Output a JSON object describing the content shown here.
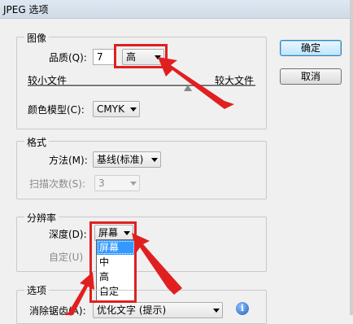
{
  "window": {
    "title": "JPEG 选项"
  },
  "buttons": {
    "ok": "确定",
    "cancel": "取消"
  },
  "image_group": {
    "title": "图像",
    "quality_label": "品质(Q):",
    "quality_value": "7",
    "quality_level": "高",
    "small_file": "较小文件",
    "large_file": "较大文件",
    "color_model_label": "颜色模型(C):",
    "color_model_value": "CMYK"
  },
  "format_group": {
    "title": "格式",
    "method_label": "方法(M):",
    "method_value": "基线(标准)",
    "scans_label": "扫描次数(S):",
    "scans_value": "3"
  },
  "resolution_group": {
    "title": "分辨率",
    "depth_label": "深度(D):",
    "depth_value": "屏幕",
    "custom_label": "自定(U)",
    "depth_options": [
      "屏幕",
      "中",
      "高",
      "自定"
    ]
  },
  "options_group": {
    "title": "选项",
    "antialias_label": "消除锯齿(A):",
    "antialias_value": "优化文字 (提示)"
  },
  "annotations": {
    "color": "#e02020"
  }
}
